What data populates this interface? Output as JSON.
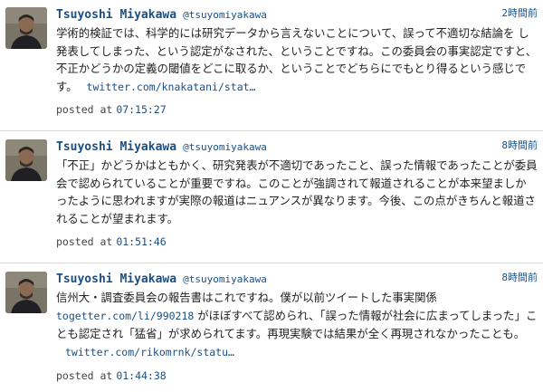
{
  "colors": {
    "link": "#1a4f85",
    "text": "#222222",
    "divider": "#d8d8d8"
  },
  "tweets": [
    {
      "display_name": "Tsuyoshi Miyakawa",
      "screen_name": "@tsuyomiyakawa",
      "relative_time": "2時間前",
      "text": "学術的検証では、科学的には研究データから言えないことについて、誤って不適切な結論を し発表してしまった、という認定がなされた、ということですね。この委員会の事実認定ですと、不正かどうかの定義の閾値をどこに取るか、ということでどちらにでもとり得るという感じです。",
      "link": "twitter.com/knakatani/stat…",
      "posted_label": "posted at",
      "posted_time": "07:15:27"
    },
    {
      "display_name": "Tsuyoshi Miyakawa",
      "screen_name": "@tsuyomiyakawa",
      "relative_time": "8時間前",
      "text": "「不正」かどうかはともかく、研究発表が不適切であったこと、誤った情報であったことが委員会で認められていることが重要ですね。このことが強調されて報道されることが本来望ましかったように思われますが実際の報道はニュアンスが異なります。今後、この点がきちんと報道されることが望まれます。",
      "posted_label": "posted at",
      "posted_time": "01:51:46"
    },
    {
      "display_name": "Tsuyoshi Miyakawa",
      "screen_name": "@tsuyomiyakawa",
      "relative_time": "8時間前",
      "text_before_link": "信州大・調査委員会の報告書はこれですね。僕が以前ツイートした事実関係",
      "inline_link": "togetter.com/li/990218",
      "text_after_link": "がほぼすべて認められ、「誤った情報が社会に広まってしまった」ことも認定され「猛省」が求められてます。再現実験では結果が全く再現されなかったことも。",
      "link": "twitter.com/rikomrnk/statu…",
      "posted_label": "posted at",
      "posted_time": "01:44:38"
    }
  ]
}
